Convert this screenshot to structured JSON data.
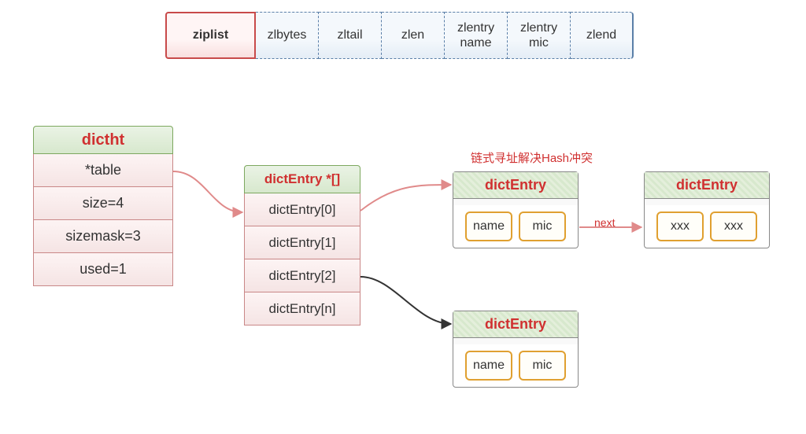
{
  "ziplist": {
    "label": "ziplist",
    "fields": [
      "zlbytes",
      "zltail",
      "zlen",
      "zlentry\nname",
      "zlentry\nmic",
      "zlend"
    ]
  },
  "dictht": {
    "title": "dictht",
    "rows": [
      "*table",
      "size=4",
      "sizemask=3",
      "used=1"
    ]
  },
  "dictEntryArr": {
    "title": "dictEntry *[]",
    "rows": [
      "dictEntry[0]",
      "dictEntry[1]",
      "dictEntry[2]",
      "dictEntry[n]"
    ]
  },
  "entries": {
    "e1": {
      "title": "dictEntry",
      "k": "name",
      "v": "mic"
    },
    "e2": {
      "title": "dictEntry",
      "k": "xxx",
      "v": "xxx"
    },
    "e3": {
      "title": "dictEntry",
      "k": "name",
      "v": "mic"
    }
  },
  "annotation": "链式寻址解决Hash冲突",
  "nextLabel": "next"
}
